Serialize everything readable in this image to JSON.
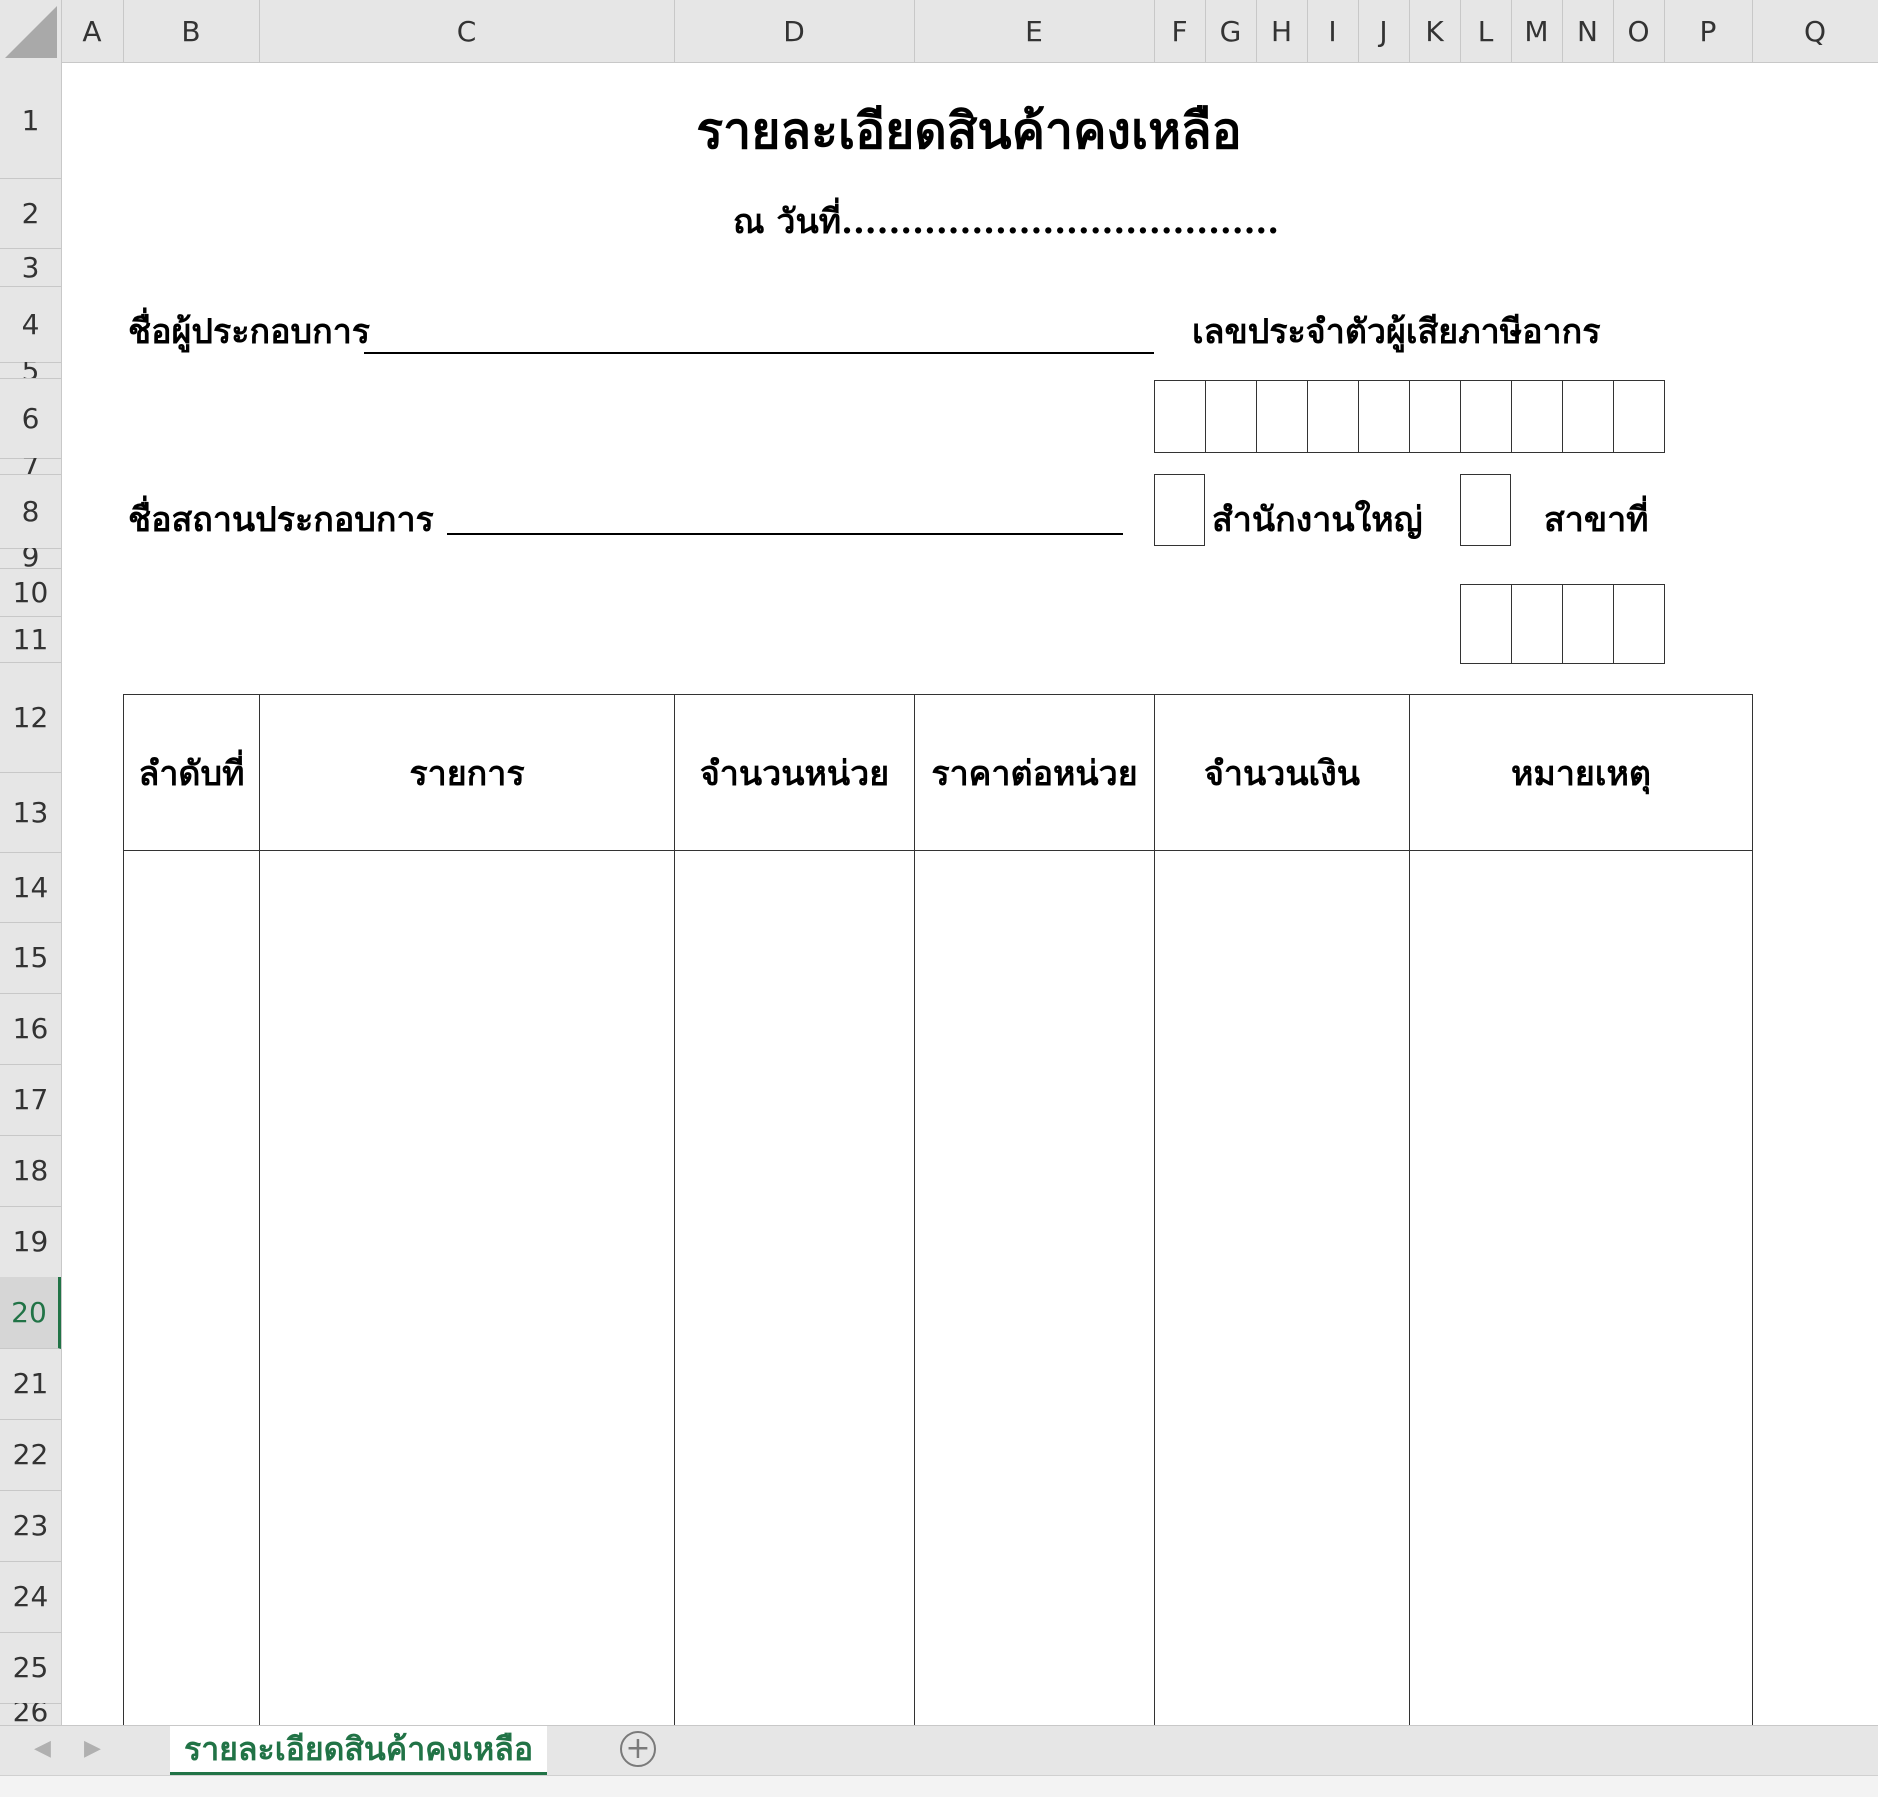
{
  "columns": [
    "A",
    "B",
    "C",
    "D",
    "E",
    "F",
    "G",
    "H",
    "I",
    "J",
    "K",
    "L",
    "M",
    "N",
    "O",
    "P",
    "Q"
  ],
  "rows": [
    {
      "n": "1"
    },
    {
      "n": "2"
    },
    {
      "n": "3"
    },
    {
      "n": "4"
    },
    {
      "n": "5"
    },
    {
      "n": "6"
    },
    {
      "n": "7"
    },
    {
      "n": "8"
    },
    {
      "n": "9"
    },
    {
      "n": "10"
    },
    {
      "n": "11"
    },
    {
      "n": "12"
    },
    {
      "n": "13"
    },
    {
      "n": "14"
    },
    {
      "n": "15"
    },
    {
      "n": "16"
    },
    {
      "n": "17"
    },
    {
      "n": "18"
    },
    {
      "n": "19"
    },
    {
      "n": "20"
    },
    {
      "n": "21"
    },
    {
      "n": "22"
    },
    {
      "n": "23"
    },
    {
      "n": "24"
    },
    {
      "n": "25"
    },
    {
      "n": "26"
    }
  ],
  "active_row": "20",
  "sheet": {
    "title": "รายละเอียดสินค้าคงเหลือ",
    "date_label": "ณ วันที่.....................................",
    "operator_name_label": "ชื่อผู้ประกอบการ",
    "establishment_name_label": "ชื่อสถานประกอบการ",
    "tax_id_label": "เลขประจำตัวผู้เสียภาษีอากร",
    "head_office_label": "สำนักงานใหญ่",
    "branch_label": "สาขาที่",
    "table_headers": [
      "ลำดับที่",
      "รายการ",
      "จำนวนหน่วย",
      "ราคาต่อหน่วย",
      "จำนวนเงิน",
      "หมายเหตุ"
    ]
  },
  "tabs": {
    "active_sheet": "รายละเอียดสินค้าคงเหลือ",
    "prev_icon": "chevron-left-icon",
    "next_icon": "chevron-right-icon",
    "add_icon": "plus-circle-icon"
  },
  "colors": {
    "accent": "#217346",
    "header_bg": "#e6e6e6",
    "grid_line": "#c8c8c8"
  }
}
